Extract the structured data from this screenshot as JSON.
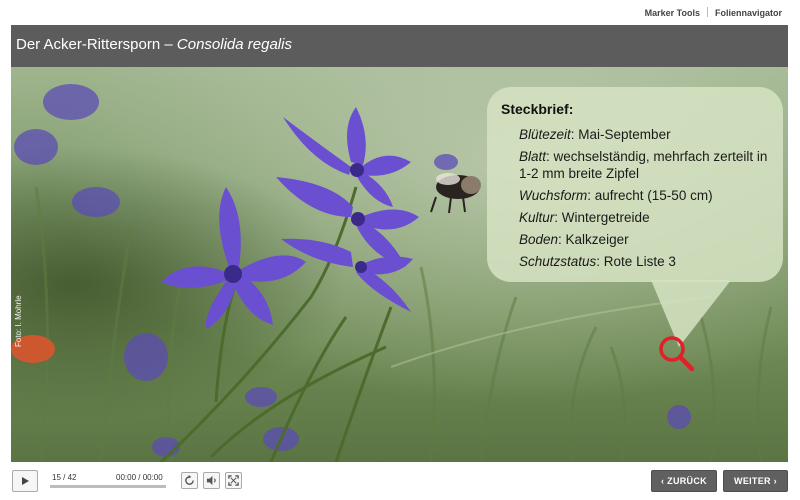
{
  "topbar": {
    "marker_tools": "Marker Tools",
    "slide_navigator": "Foliennavigator"
  },
  "slide": {
    "title_plain": "Der Acker-Rittersporn – ",
    "title_italic": "Consolida regalis",
    "photo_credit": "Foto: I. Mohrle"
  },
  "factsheet": {
    "heading": "Steckbrief:",
    "items": [
      {
        "key": "Blütezeit",
        "value": ": Mai-September"
      },
      {
        "key": "Blatt",
        "value": ": wechselständig, mehrfach zerteilt in 1-2 mm breite Zipfel"
      },
      {
        "key": "Wuchsform",
        "value": ": aufrecht (15-50 cm)"
      },
      {
        "key": "Kultur",
        "value": ": Wintergetreide"
      },
      {
        "key": "Boden",
        "value": ": Kalkzeiger"
      },
      {
        "key": "Schutzstatus",
        "value": ": Rote Liste 3"
      }
    ]
  },
  "player": {
    "slide_counter": "15 / 42",
    "time": "00:00 / 00:00",
    "progress_fraction": 0,
    "back_label": "ZURÜCK",
    "next_label": "WEITER"
  },
  "icons": {
    "play": "play-icon",
    "replay": "replay-icon",
    "volume": "volume-icon",
    "fullscreen": "fullscreen-icon",
    "magnifier": "magnifier-icon",
    "bee": "bee-illustration"
  },
  "colors": {
    "title_bar": "#5c5c5c",
    "bubble": "#d6e4c4",
    "flower": "#6a4fd1",
    "magnifier": "#e0202a",
    "nav_button": "#606060"
  }
}
